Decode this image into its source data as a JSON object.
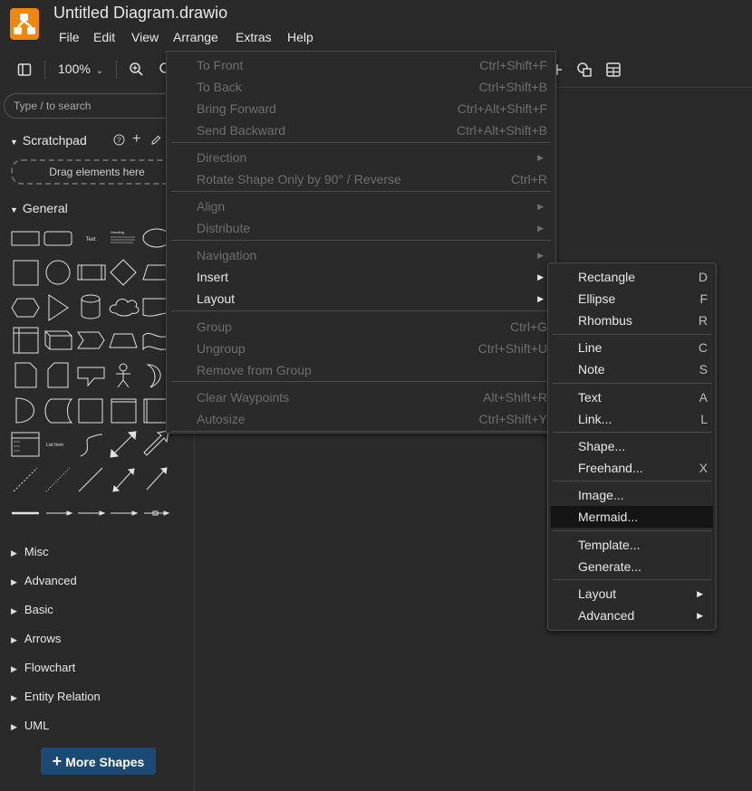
{
  "app": {
    "title": "Untitled Diagram.drawio",
    "menubar": [
      "File",
      "Edit",
      "View",
      "Arrange",
      "Extras",
      "Help"
    ]
  },
  "toolbar": {
    "zoom": "100%"
  },
  "sidebar": {
    "search_placeholder": "Type / to search",
    "scratchpad": {
      "title": "Scratchpad",
      "drop_hint": "Drag elements here"
    },
    "general": {
      "title": "General",
      "shape_text": "Text",
      "shape_heading": "Heading",
      "shape_list": "List Item"
    },
    "collapsed_sections": [
      "Misc",
      "Advanced",
      "Basic",
      "Arrows",
      "Flowchart",
      "Entity Relation",
      "UML"
    ],
    "more_shapes": "More Shapes"
  },
  "arrange_menu": [
    {
      "label": "To Front",
      "shortcut": "Ctrl+Shift+F",
      "enabled": false
    },
    {
      "label": "To Back",
      "shortcut": "Ctrl+Shift+B",
      "enabled": false
    },
    {
      "label": "Bring Forward",
      "shortcut": "Ctrl+Alt+Shift+F",
      "enabled": false
    },
    {
      "label": "Send Backward",
      "shortcut": "Ctrl+Alt+Shift+B",
      "enabled": false
    },
    {
      "label": "Direction",
      "shortcut": "",
      "enabled": false,
      "submenu": true
    },
    {
      "label": "Rotate Shape Only by 90° / Reverse",
      "shortcut": "Ctrl+R",
      "enabled": false
    },
    {
      "label": "Align",
      "shortcut": "",
      "enabled": false,
      "submenu": true
    },
    {
      "label": "Distribute",
      "shortcut": "",
      "enabled": false,
      "submenu": true
    },
    {
      "label": "Navigation",
      "shortcut": "",
      "enabled": false,
      "submenu": true
    },
    {
      "label": "Insert",
      "shortcut": "",
      "enabled": true,
      "submenu": true
    },
    {
      "label": "Layout",
      "shortcut": "",
      "enabled": true,
      "submenu": true
    },
    {
      "label": "Group",
      "shortcut": "Ctrl+G",
      "enabled": false
    },
    {
      "label": "Ungroup",
      "shortcut": "Ctrl+Shift+U",
      "enabled": false
    },
    {
      "label": "Remove from Group",
      "shortcut": "",
      "enabled": false
    },
    {
      "label": "Clear Waypoints",
      "shortcut": "Alt+Shift+R",
      "enabled": false
    },
    {
      "label": "Autosize",
      "shortcut": "Ctrl+Shift+Y",
      "enabled": false
    }
  ],
  "insert_menu": [
    {
      "label": "Rectangle",
      "shortcut": "D"
    },
    {
      "label": "Ellipse",
      "shortcut": "F"
    },
    {
      "label": "Rhombus",
      "shortcut": "R"
    },
    {
      "label": "Line",
      "shortcut": "C"
    },
    {
      "label": "Note",
      "shortcut": "S"
    },
    {
      "label": "Text",
      "shortcut": "A"
    },
    {
      "label": "Link...",
      "shortcut": "L"
    },
    {
      "label": "Shape...",
      "shortcut": ""
    },
    {
      "label": "Freehand...",
      "shortcut": "X"
    },
    {
      "label": "Image...",
      "shortcut": ""
    },
    {
      "label": "Mermaid...",
      "shortcut": "",
      "highlighted": true
    },
    {
      "label": "Template...",
      "shortcut": ""
    },
    {
      "label": "Generate...",
      "shortcut": ""
    },
    {
      "label": "Layout",
      "shortcut": "",
      "submenu": true
    },
    {
      "label": "Advanced",
      "shortcut": "",
      "submenu": true
    }
  ],
  "colors": {
    "accent": "#f08705",
    "more_shapes_bg": "#1c4a74",
    "menu_highlight": "#141414"
  }
}
